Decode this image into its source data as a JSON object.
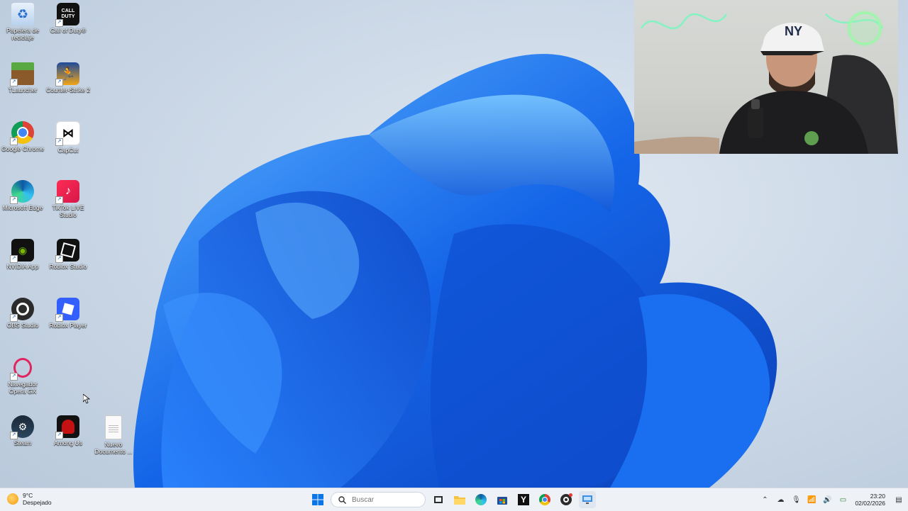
{
  "desktop": {
    "icons": [
      {
        "label": "Papelera de reciclaje",
        "icon": "recycle-bin-icon"
      },
      {
        "label": "Call of Duty®",
        "icon": "call-of-duty-icon"
      },
      {
        "label": "TLauncher",
        "icon": "tlauncher-icon"
      },
      {
        "label": "Counter-Strike 2",
        "icon": "counter-strike-icon"
      },
      {
        "label": "Google Chrome",
        "icon": "chrome-icon"
      },
      {
        "label": "CapCut",
        "icon": "capcut-icon"
      },
      {
        "label": "Microsoft Edge",
        "icon": "edge-icon"
      },
      {
        "label": "TikTok LIVE Studio",
        "icon": "tiktok-icon"
      },
      {
        "label": "NVIDIA App",
        "icon": "nvidia-icon"
      },
      {
        "label": "Roblox Studio",
        "icon": "roblox-studio-icon"
      },
      {
        "label": "OBS Studio",
        "icon": "obs-icon"
      },
      {
        "label": "Roblox Player",
        "icon": "roblox-player-icon"
      },
      {
        "label": "Navegador Opera GX",
        "icon": "opera-gx-icon"
      },
      {
        "label": "Steam",
        "icon": "steam-icon"
      },
      {
        "label": "Among Us",
        "icon": "among-us-icon"
      },
      {
        "label": "Nuevo Documento ...",
        "icon": "text-document-icon"
      }
    ]
  },
  "taskbar": {
    "weather": {
      "temp": "9°C",
      "condition": "Despejado",
      "icon": "sun-icon"
    },
    "search": {
      "placeholder": "Buscar"
    },
    "apps": [
      "start-icon",
      "task-view-icon",
      "file-explorer-icon",
      "edge-icon",
      "store-icon",
      "yahoo-icon",
      "chrome-icon",
      "obs-icon",
      "remote-desktop-icon"
    ],
    "clock": {
      "time": "23:20",
      "date": "02/02/2026"
    }
  },
  "colors": {
    "taskbar_bg": "#eef1f6",
    "accent": "#0a5ce8",
    "bloom": "#1a6ef0"
  }
}
